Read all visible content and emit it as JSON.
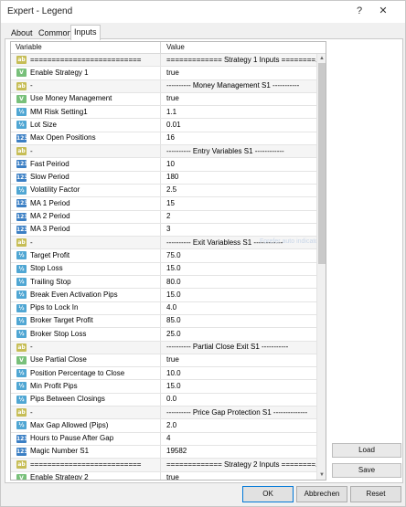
{
  "window": {
    "title": "Expert - Legend",
    "help_glyph": "?",
    "close_glyph": "✕"
  },
  "tabs": [
    {
      "label": "About"
    },
    {
      "label": "Common"
    },
    {
      "label": "Inputs"
    }
  ],
  "grid": {
    "columns": [
      "Variable",
      "Value"
    ],
    "rows": [
      {
        "icon": "ab",
        "name": "==========================",
        "value": "============= Strategy 1 Inputs ========..."
      },
      {
        "icon": "bool",
        "name": "Enable Strategy 1",
        "value": "true"
      },
      {
        "icon": "ab",
        "name": "-",
        "value": "---------- Money Management S1 -----------"
      },
      {
        "icon": "bool",
        "name": "Use Money Management",
        "value": "true"
      },
      {
        "icon": "dbl",
        "name": "MM Risk Setting1",
        "value": "1.1"
      },
      {
        "icon": "dbl",
        "name": "Lot Size",
        "value": "0.01"
      },
      {
        "icon": "int",
        "name": "Max Open Positions",
        "value": "16"
      },
      {
        "icon": "ab",
        "name": "-",
        "value": "---------- Entry Variables S1 ------------"
      },
      {
        "icon": "int",
        "name": "Fast Peiriod",
        "value": "10"
      },
      {
        "icon": "int",
        "name": "Slow Period",
        "value": "180"
      },
      {
        "icon": "dbl",
        "name": "Volatility Factor",
        "value": "2.5"
      },
      {
        "icon": "int",
        "name": "MA 1 Period",
        "value": "15"
      },
      {
        "icon": "int",
        "name": "MA 2 Period",
        "value": "2"
      },
      {
        "icon": "int",
        "name": "MA 3 Period",
        "value": "3"
      },
      {
        "icon": "ab",
        "name": "-",
        "value": "---------- Exit Variabless S1 ------------"
      },
      {
        "icon": "dbl",
        "name": "Target Profit",
        "value": "75.0"
      },
      {
        "icon": "dbl",
        "name": "Stop Loss",
        "value": "15.0"
      },
      {
        "icon": "dbl",
        "name": "Trailing Stop",
        "value": "80.0"
      },
      {
        "icon": "dbl",
        "name": "Break Even Activation Pips",
        "value": "15.0"
      },
      {
        "icon": "dbl",
        "name": "Pips to Lock In",
        "value": "4.0"
      },
      {
        "icon": "dbl",
        "name": "Broker Target Profit",
        "value": "85.0"
      },
      {
        "icon": "dbl",
        "name": "Broker Stop Loss",
        "value": "25.0"
      },
      {
        "icon": "ab",
        "name": "-",
        "value": "---------- Partial Close Exit S1 -----------"
      },
      {
        "icon": "bool",
        "name": "Use Partial Close",
        "value": "true"
      },
      {
        "icon": "dbl",
        "name": "Position Percentage to Close",
        "value": "10.0"
      },
      {
        "icon": "dbl",
        "name": "Min Profit Pips",
        "value": "15.0"
      },
      {
        "icon": "dbl",
        "name": "Pips Between Closings",
        "value": "0.0"
      },
      {
        "icon": "ab",
        "name": "-",
        "value": "---------- Price Gap Protection S1 --------------"
      },
      {
        "icon": "dbl",
        "name": "Max Gap Allowed (Pips)",
        "value": "2.0"
      },
      {
        "icon": "int",
        "name": "Hours to Pause After Gap",
        "value": "4"
      },
      {
        "icon": "int",
        "name": "Magic Number S1",
        "value": "19582"
      },
      {
        "icon": "ab",
        "name": "==========================",
        "value": "============= Strategy 2 Inputs ========..."
      },
      {
        "icon": "bool",
        "name": "Enable Strategy 2",
        "value": "true"
      }
    ],
    "watermark": "Forefer auto indicators"
  },
  "buttons": {
    "load": "Load",
    "save": "Save",
    "ok": "OK",
    "cancel": "Abbrechen",
    "reset": "Reset"
  },
  "colors": {
    "ab_icon": "#c6bd55",
    "bool_icon": "#78c07a",
    "double_icon": "#4fa6d3",
    "int_icon": "#3b7fc4",
    "ok_border": "#0078d7"
  }
}
